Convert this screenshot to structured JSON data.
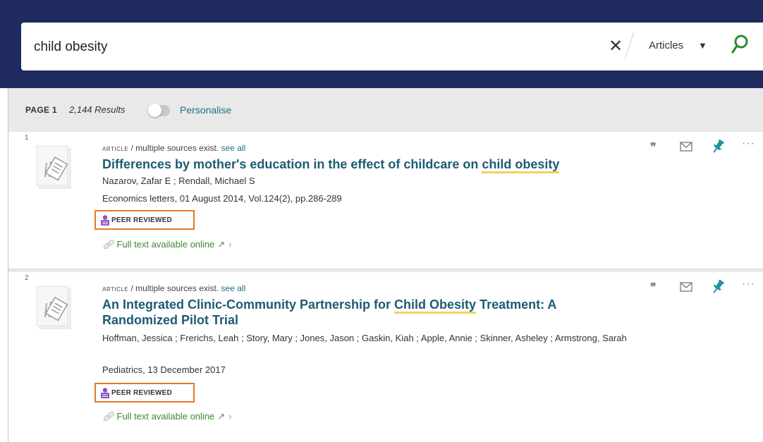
{
  "search": {
    "query": "child obesity",
    "scope": "Articles"
  },
  "results_header": {
    "page_label": "PAGE 1",
    "results_count": "2,144 Results",
    "personalise_label": "Personalise"
  },
  "results": [
    {
      "number": "1",
      "type": "article",
      "sources_note": "/ multiple sources exist.",
      "see_all": "see all",
      "title_before": "Differences by mother's education in the effect of childcare on ",
      "title_highlight": "child obesity",
      "title_after": "",
      "authors": "Nazarov, Zafar E ; Rendall, Michael S",
      "source": "Economics letters, 01 August 2014, Vol.124(2), pp.286-289",
      "peer_reviewed": "PEER REVIEWED",
      "fulltext": "Full text available online"
    },
    {
      "number": "2",
      "type": "article",
      "sources_note": "/ multiple sources exist.",
      "see_all": "see all",
      "title_before": "An Integrated Clinic-Community Partnership for ",
      "title_highlight": "Child Obesity",
      "title_after": " Treatment: A Randomized Pilot Trial",
      "authors": "Hoffman, Jessica ; Frerichs, Leah ; Story, Mary ; Jones, Jason ; Gaskin, Kiah ; Apple, Annie ; Skinner, Asheley ; Armstrong, Sarah",
      "source": "Pediatrics, 13 December 2017",
      "peer_reviewed": "PEER REVIEWED",
      "fulltext": "Full text available online"
    }
  ],
  "icons": {
    "clear": "close-icon",
    "caret": "caret-down-icon",
    "search": "magnifier-icon",
    "cite": "quote-icon",
    "email": "envelope-icon",
    "pin": "pin-icon",
    "more": "more-icon",
    "peer": "peer-reviewed-icon",
    "link": "link-icon",
    "external": "external-link-icon"
  },
  "colors": {
    "header_bg": "#1f2a5e",
    "link": "#1d5b73",
    "highlight": "#f3d163",
    "fulltext": "#3a8a2e",
    "peer_box": "#e07a2a",
    "pin": "#1e8fa3",
    "search_icon": "#2e8b2e",
    "peer_icon": "#8e4fc2"
  }
}
